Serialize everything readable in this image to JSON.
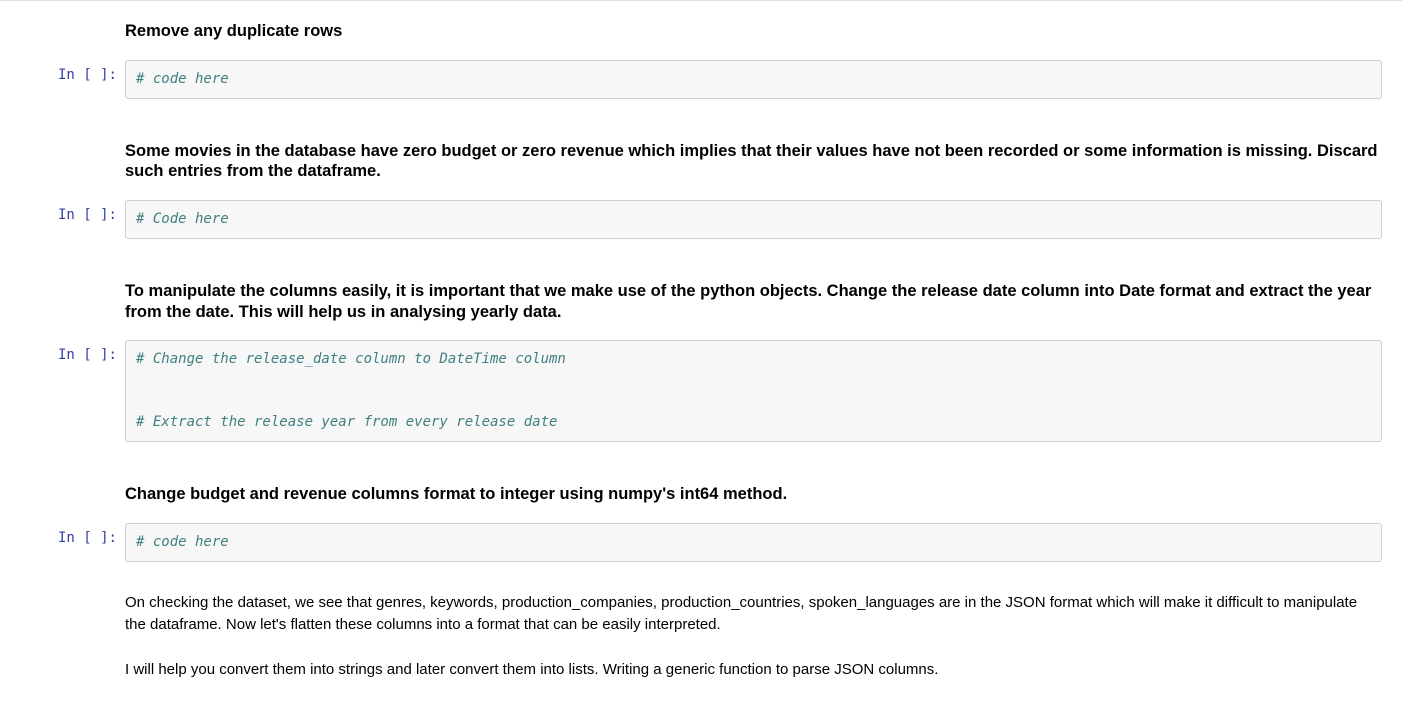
{
  "prompts": {
    "code_prompt": "In [ ]:"
  },
  "cells": [
    {
      "heading": "Remove any duplicate rows"
    },
    {
      "code_comment": "# code here"
    },
    {
      "heading": "Some movies in the database have zero budget or zero revenue which implies that their values have not been recorded or some information is missing. Discard such entries from the dataframe."
    },
    {
      "code_comment": "# Code here"
    },
    {
      "heading": "To manipulate the columns easily, it is important that we make use of the python objects. Change the release date column into Date format and extract the year from the date. This will help us in analysing yearly data."
    },
    {
      "code_line1": "# Change the release_date column to DateTime column",
      "code_line2": "# Extract the release year from every release date"
    },
    {
      "heading": "Change budget and revenue columns format to integer using numpy's int64 method."
    },
    {
      "code_comment": "# code here"
    },
    {
      "paragraph1": "On checking the dataset, we see that genres, keywords, production_companies, production_countries, spoken_languages are in the JSON format which will make it difficult to manipulate the dataframe. Now let's flatten these columns into a format that can be easily interpreted.",
      "paragraph2": "I will help you convert them into strings and later convert them into lists. Writing a generic function to parse JSON columns."
    }
  ]
}
